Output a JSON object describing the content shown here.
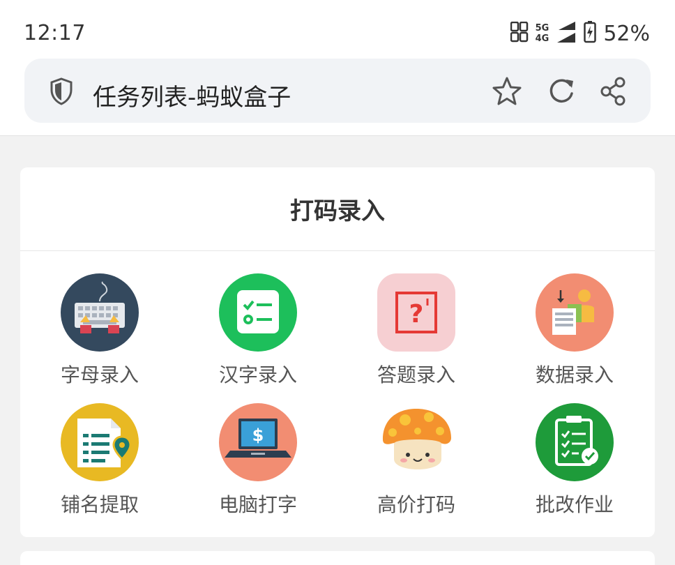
{
  "status_bar": {
    "time": "12:17",
    "network_top": "5G",
    "network_bottom": "4G",
    "battery": "52%"
  },
  "browser": {
    "page_title": "任务列表-蚂蚁盒子",
    "icons": [
      "shield-icon",
      "star-icon",
      "refresh-icon",
      "share-icon"
    ]
  },
  "section": {
    "title": "打码录入",
    "items": [
      {
        "label": "字母录入",
        "icon": "keyboard-icon",
        "color": "#34495e"
      },
      {
        "label": "汉字录入",
        "icon": "checklist-icon",
        "color": "#1dbf5b"
      },
      {
        "label": "答题录入",
        "icon": "question-icon",
        "color": "#f6cfd2"
      },
      {
        "label": "数据录入",
        "icon": "data-entry-icon",
        "color": "#f28d72"
      },
      {
        "label": "铺名提取",
        "icon": "document-pin-icon",
        "color": "#e8b923"
      },
      {
        "label": "电脑打字",
        "icon": "laptop-dollar-icon",
        "color": "#f28d72"
      },
      {
        "label": "高价打码",
        "icon": "mushroom-icon",
        "color": "#f4922e"
      },
      {
        "label": "批改作业",
        "icon": "clipboard-check-icon",
        "color": "#1e9b3a"
      }
    ]
  }
}
